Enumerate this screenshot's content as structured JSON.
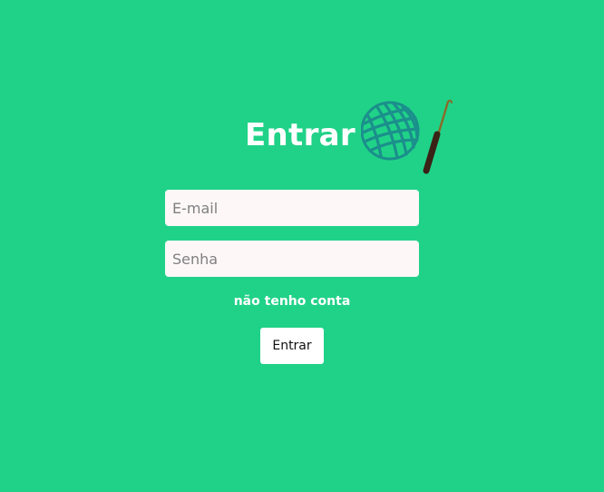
{
  "login": {
    "title": "Entrar",
    "title_icon": "yarn-ball-crochet-hook-icon",
    "email_placeholder": "E-mail",
    "password_placeholder": "Senha",
    "signup_link": "não tenho conta",
    "submit_label": "Entrar"
  },
  "colors": {
    "background": "#20d288",
    "field_background": "#fdf7f8",
    "yarn": "#1b8f8c",
    "hook_handle": "#3a2216",
    "hook_shaft": "#8a6a2a"
  }
}
